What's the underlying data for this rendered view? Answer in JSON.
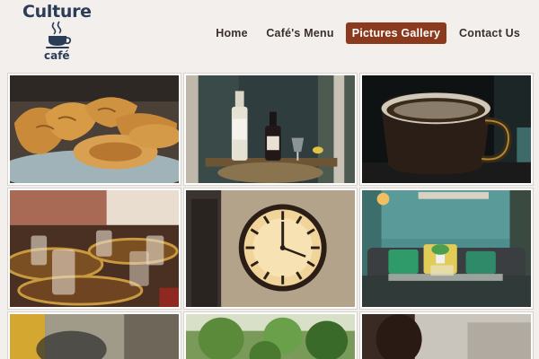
{
  "brand": {
    "name_top": "Culture",
    "name_bottom": "café",
    "logo_icon": "coffee-cup-icon",
    "color": "#2b3d56"
  },
  "nav": {
    "items": [
      {
        "label": "Home",
        "active": false
      },
      {
        "label": "Café's Menu",
        "active": false
      },
      {
        "label": "Pictures Gallery",
        "active": true
      },
      {
        "label": "Contact Us",
        "active": false
      }
    ],
    "active_color": "#8b3a1e"
  },
  "gallery": {
    "photos": [
      {
        "subject": "pastries-photo"
      },
      {
        "subject": "wine-bottles-photo"
      },
      {
        "subject": "coffee-cup-photo"
      },
      {
        "subject": "glasses-on-trays-photo"
      },
      {
        "subject": "wall-clock-photo"
      },
      {
        "subject": "lounge-sofa-photo"
      },
      {
        "subject": "blurred-interior-photo"
      },
      {
        "subject": "garden-photo"
      },
      {
        "subject": "person-photo"
      }
    ]
  }
}
